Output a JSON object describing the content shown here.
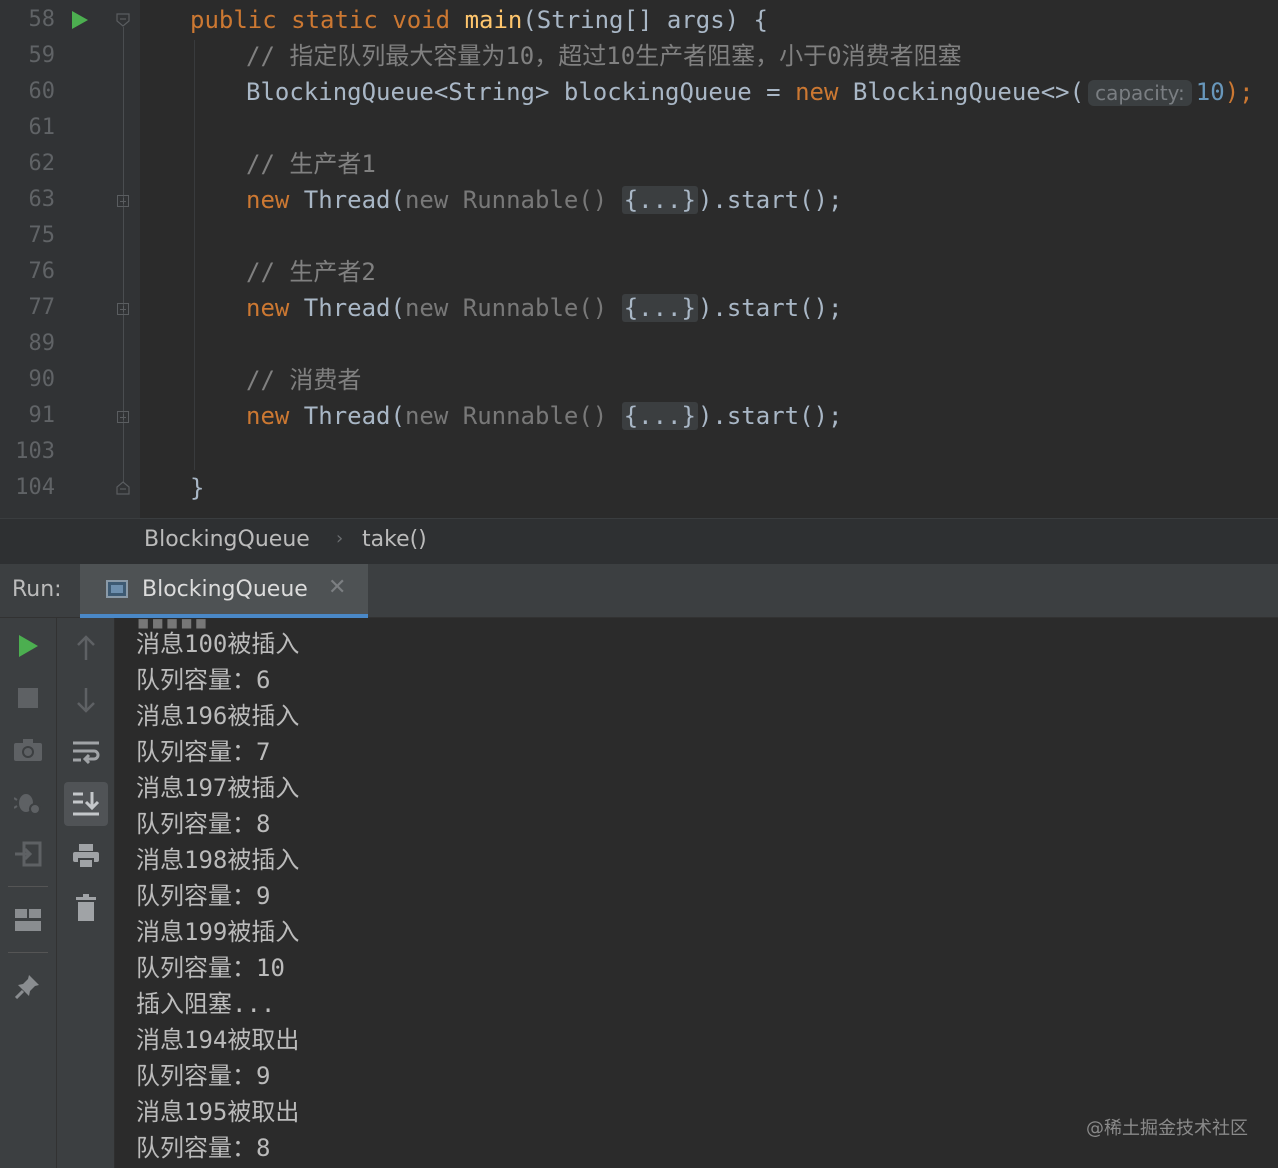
{
  "editor": {
    "line_numbers": [
      "58",
      "59",
      "60",
      "61",
      "62",
      "63",
      "75",
      "76",
      "77",
      "89",
      "90",
      "91",
      "103",
      "104"
    ],
    "code": {
      "l58": {
        "kw1": "public",
        "kw2": "static",
        "kw3": "void",
        "fn": "main",
        "rest": "(String[] args) {"
      },
      "l59": {
        "comment": "// 指定队列最大容量为10，超过10生产者阻塞，小于0消费者阻塞"
      },
      "l60": {
        "decl": "BlockingQueue<String> blockingQueue = ",
        "kw": "new",
        "ctor": " BlockingQueue<>(",
        "hint": "capacity:",
        "num": "10",
        "end": ");"
      },
      "l62": {
        "comment": "// 生产者1"
      },
      "l63": {
        "kw": "new",
        "a": " Thread(",
        "dim": "new Runnable()",
        "folded": "{...}",
        "end": ").start();"
      },
      "l76": {
        "comment": "// 生产者2"
      },
      "l77": {
        "kw": "new",
        "a": " Thread(",
        "dim": "new Runnable()",
        "folded": "{...}",
        "end": ").start();"
      },
      "l90": {
        "comment": "// 消费者"
      },
      "l91": {
        "kw": "new",
        "a": " Thread(",
        "dim": "new Runnable()",
        "folded": "{...}",
        "end": ").start();"
      },
      "l104": {
        "brace": "}"
      }
    }
  },
  "breadcrumb": {
    "class": "BlockingQueue",
    "method": "take()"
  },
  "run_panel": {
    "label": "Run:",
    "tab_title": "BlockingQueue",
    "output": [
      "消息100被插入",
      "队列容量：6",
      "消息196被插入",
      "队列容量：7",
      "消息197被插入",
      "队列容量：8",
      "消息198被插入",
      "队列容量：9",
      "消息199被插入",
      "队列容量：10",
      "插入阻塞...",
      "消息194被取出",
      "队列容量：9",
      "消息195被取出",
      "队列容量：8"
    ]
  },
  "watermark": "@稀土掘金技术社区",
  "colors": {
    "keyword": "#cc7832",
    "function": "#ffc66d",
    "comment": "#808080",
    "number": "#6897bb",
    "accent": "#4a88c7",
    "run_green": "#4caf50"
  }
}
